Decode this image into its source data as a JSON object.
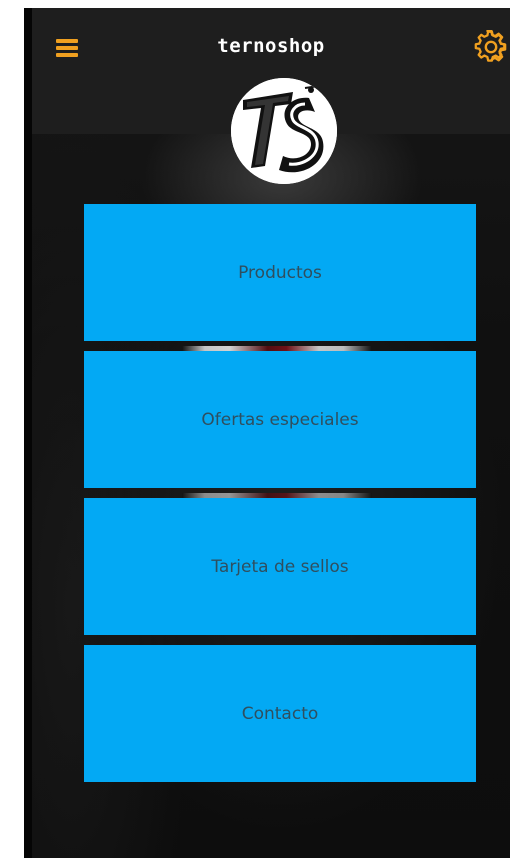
{
  "header": {
    "title": "ternoshop",
    "menu_icon": "hamburger-menu-icon",
    "settings_icon": "gear-icon",
    "logo_text": "TS"
  },
  "menu": {
    "items": [
      {
        "label": "Productos"
      },
      {
        "label": "Ofertas especiales"
      },
      {
        "label": "Tarjeta de sellos"
      },
      {
        "label": "Contacto"
      }
    ]
  },
  "colors": {
    "accent": "#f0a020",
    "button": "#03a9f4",
    "button_text": "#2f4f5f",
    "header_bg": "#1e1e1e"
  }
}
